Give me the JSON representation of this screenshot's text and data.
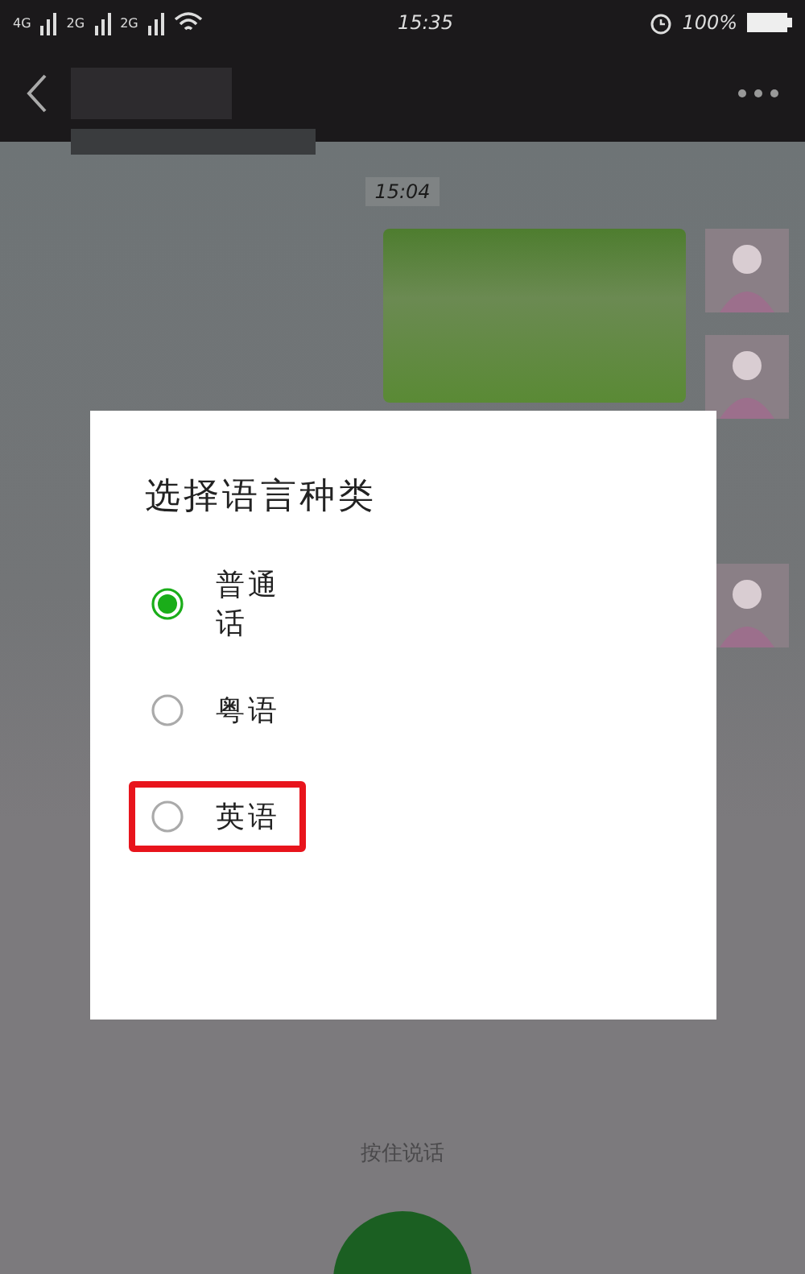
{
  "status_bar": {
    "network_labels": [
      "4G",
      "2G",
      "2G"
    ],
    "time": "15:35",
    "battery": "100%"
  },
  "chat": {
    "timestamp": "15:04",
    "hold_to_talk": "按住说话"
  },
  "dialog": {
    "title": "选择语言种类",
    "options": [
      {
        "label": "普通话",
        "selected": true,
        "highlighted": false
      },
      {
        "label": "粤语",
        "selected": false,
        "highlighted": false
      },
      {
        "label": "英语",
        "selected": false,
        "highlighted": true
      }
    ]
  }
}
